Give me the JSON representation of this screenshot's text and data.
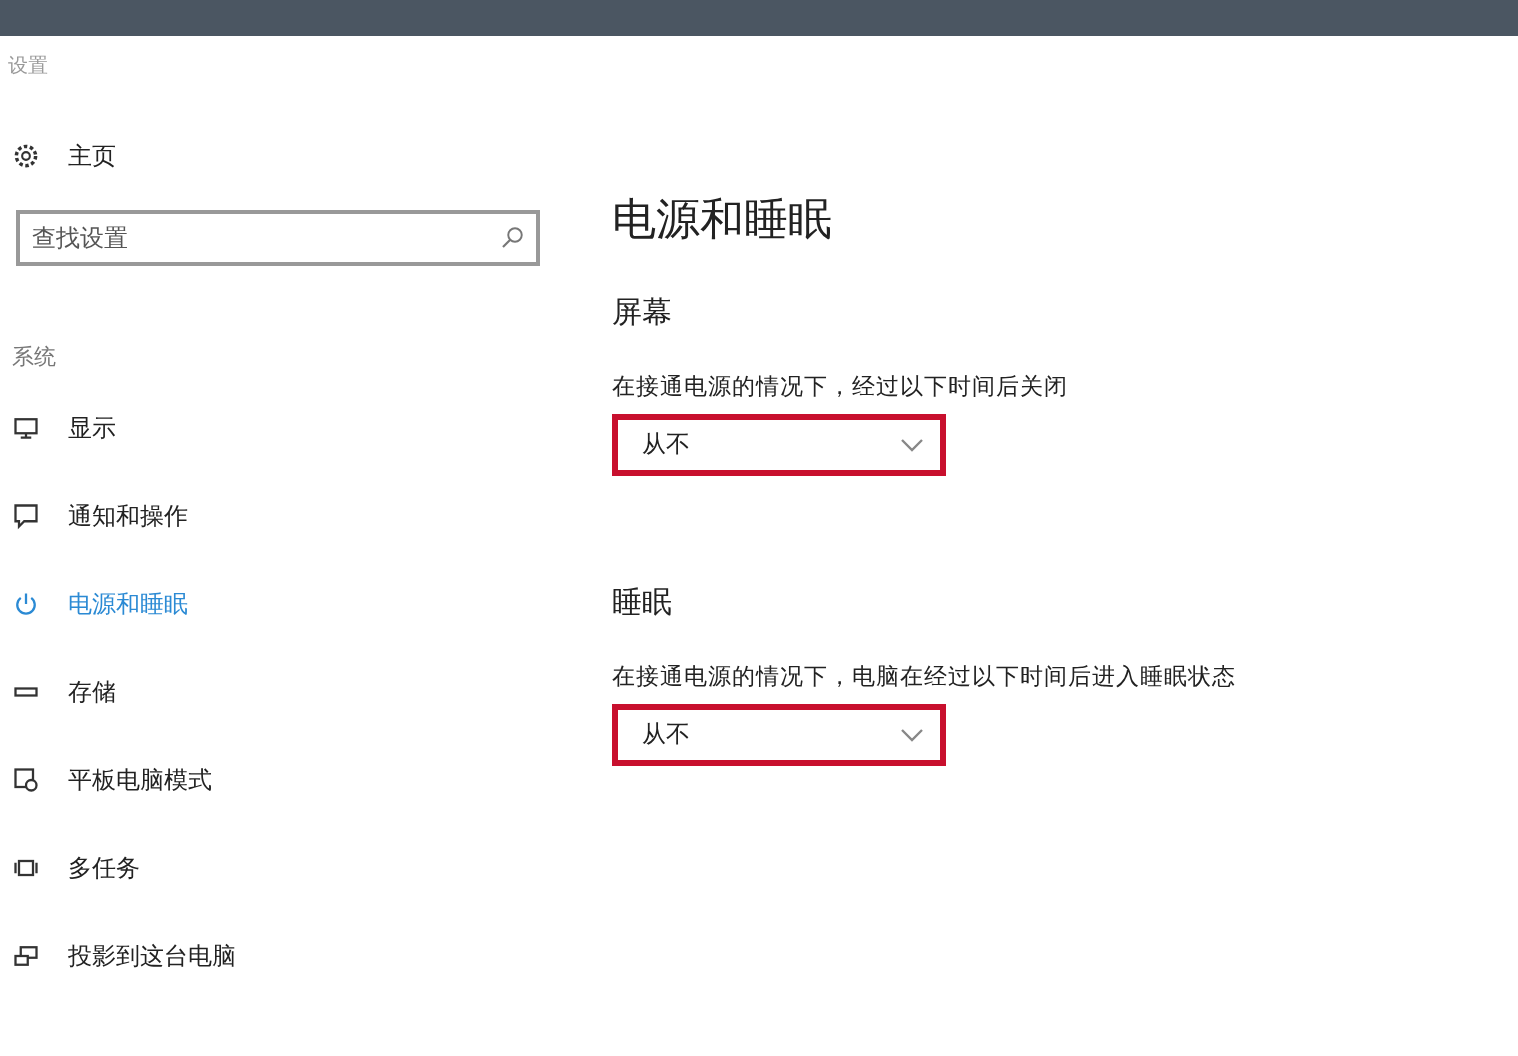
{
  "window": {
    "title": "设置"
  },
  "sidebar": {
    "home": "主页",
    "search": {
      "placeholder": "查找设置"
    },
    "section": "系统",
    "items": [
      {
        "label": "显示",
        "selected": false
      },
      {
        "label": "通知和操作",
        "selected": false
      },
      {
        "label": "电源和睡眠",
        "selected": true
      },
      {
        "label": "存储",
        "selected": false
      },
      {
        "label": "平板电脑模式",
        "selected": false
      },
      {
        "label": "多任务",
        "selected": false
      },
      {
        "label": "投影到这台电脑",
        "selected": false
      }
    ]
  },
  "main": {
    "title": "电源和睡眠",
    "sections": [
      {
        "heading": "屏幕",
        "description": "在接通电源的情况下，经过以下时间后关闭",
        "dropdown": {
          "value": "从不",
          "highlighted": true
        }
      },
      {
        "heading": "睡眠",
        "description": "在接通电源的情况下，电脑在经过以下时间后进入睡眠状态",
        "dropdown": {
          "value": "从不",
          "highlighted": true
        }
      }
    ]
  }
}
